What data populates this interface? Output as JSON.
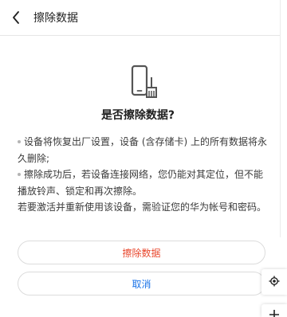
{
  "header": {
    "back_icon": "chevron-left-icon",
    "title": "擦除数据"
  },
  "main": {
    "icon": "phone-with-broom-icon",
    "question": "是否擦除数据?",
    "bullets": [
      "设备将恢复出厂设置，设备 (含存储卡) 上的所有数据将永久删除;",
      "擦除成功后，若设备连接网络，您仍能对其定位，但不能播放铃声、锁定和再次擦除。"
    ],
    "note": "若要激活并重新使用该设备，需验证您的华为帐号和密码。"
  },
  "buttons": {
    "erase_label": "擦除数据",
    "cancel_label": "取消"
  },
  "map_controls": {
    "locate_icon": "locate-icon",
    "zoom_icon": "plus-icon"
  },
  "colors": {
    "danger": "#e8472d",
    "link": "#1a73e8"
  }
}
